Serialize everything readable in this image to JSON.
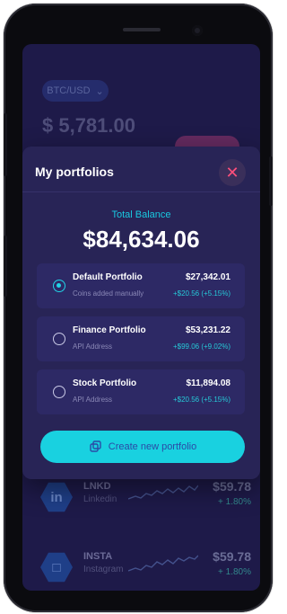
{
  "background": {
    "pair_selector": "BTC/USD",
    "price": "$ 5,781.00",
    "watchlist": [
      {
        "badge": "in",
        "symbol": "LNKD",
        "name": "Linkedin",
        "price": "$59.78",
        "change": "+ 1.80%"
      },
      {
        "badge": "□",
        "symbol": "INSTA",
        "name": "Instagram",
        "price": "$59.78",
        "change": "+ 1.80%"
      }
    ]
  },
  "sheet": {
    "title": "My portfolios",
    "total_label": "Total Balance",
    "total_value": "$84,634.06",
    "portfolios": [
      {
        "name": "Default Portfolio",
        "sub": "Coins added manually",
        "amount": "$27,342.01",
        "delta": "+$20.56 (+5.15%)",
        "selected": true
      },
      {
        "name": "Finance Portfolio",
        "sub": "API Address",
        "amount": "$53,231.22",
        "delta": "+$99.06 (+9.02%)",
        "selected": false
      },
      {
        "name": "Stock Portfolio",
        "sub": "API Address",
        "amount": "$11,894.08",
        "delta": "+$20.56 (+5.15%)",
        "selected": false
      }
    ],
    "create_label": "Create new portfolio"
  },
  "colors": {
    "accent": "#19d1e0",
    "background": "#1e1a49",
    "sheet": "#282456",
    "close": "#ff4f7b"
  },
  "icons": {
    "close": "close-icon",
    "create": "copy-icon",
    "chevron": "chevron-down-icon"
  }
}
